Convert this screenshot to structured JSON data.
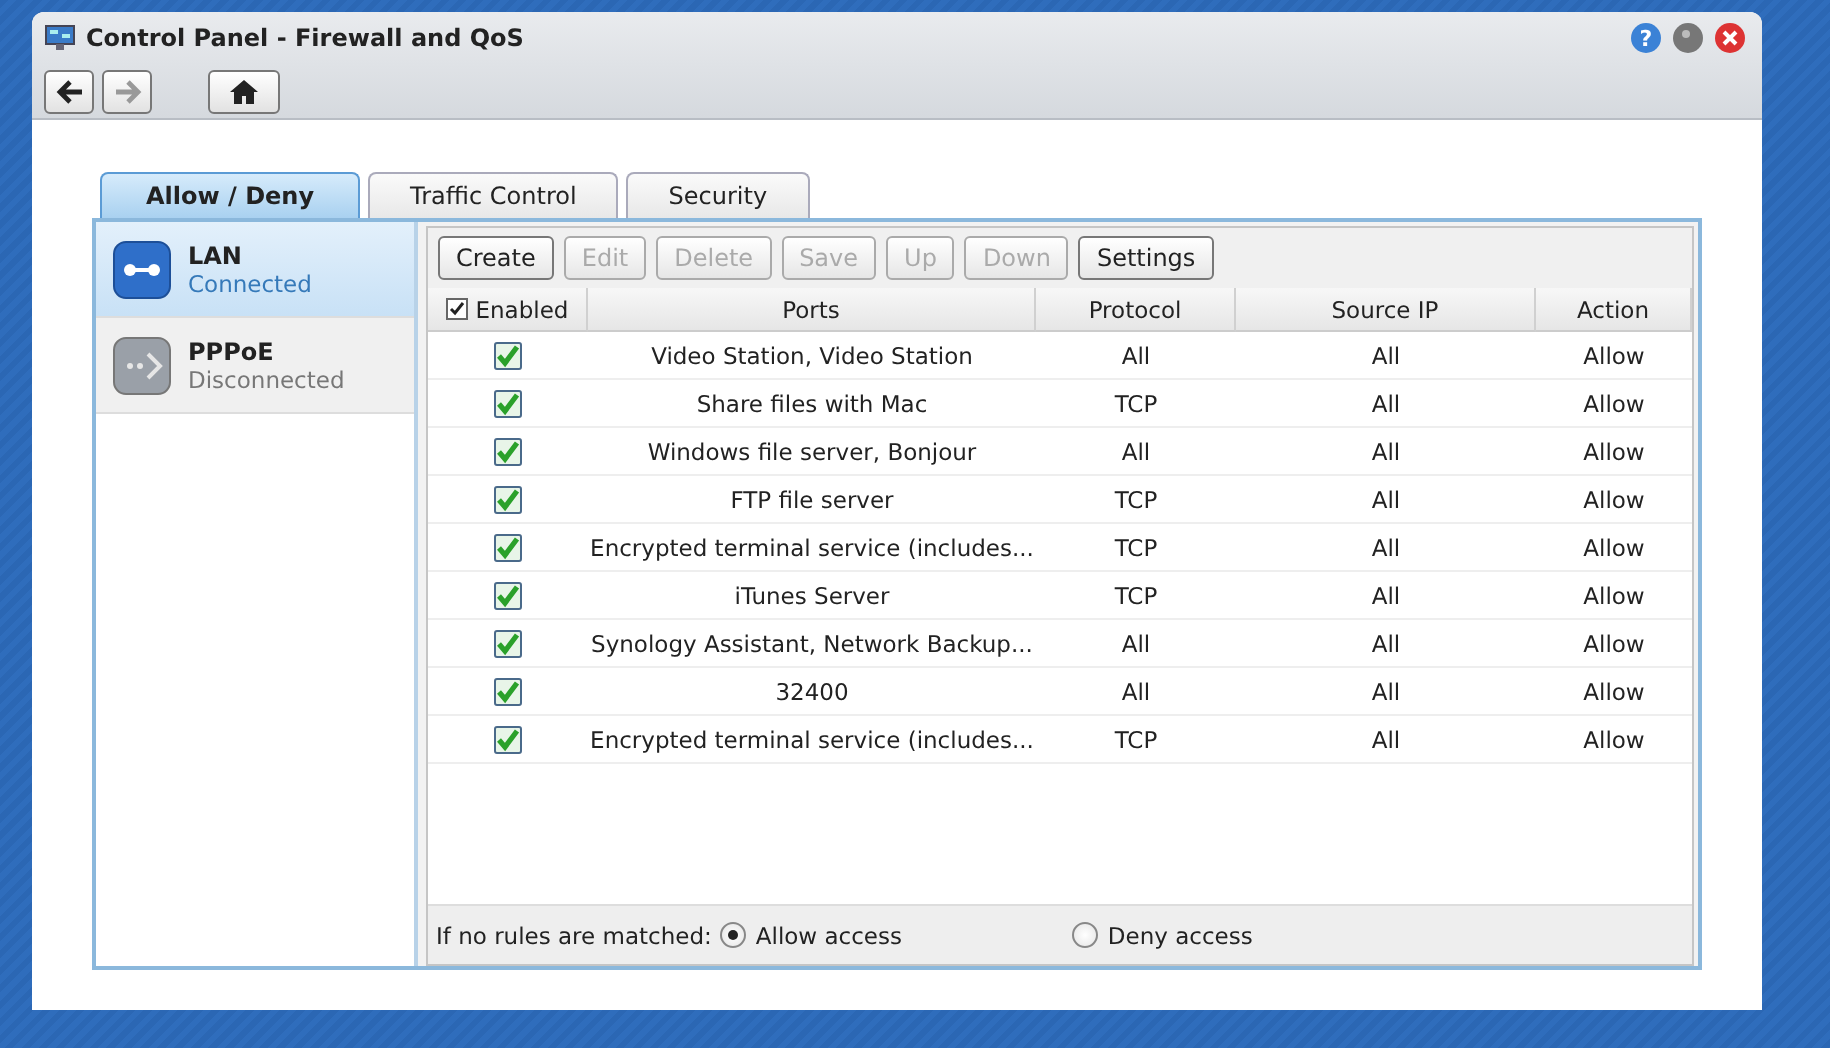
{
  "window": {
    "title": "Control Panel - Firewall and QoS",
    "help_glyph": "?"
  },
  "nav": {
    "back_disabled": false,
    "forward_disabled": true
  },
  "tabs": [
    {
      "label": "Allow / Deny",
      "selected": true
    },
    {
      "label": "Traffic Control",
      "selected": false
    },
    {
      "label": "Security",
      "selected": false
    }
  ],
  "interfaces": [
    {
      "name": "LAN",
      "status": "Connected",
      "selected": true,
      "connected": true
    },
    {
      "name": "PPPoE",
      "status": "Disconnected",
      "selected": false,
      "connected": false
    }
  ],
  "toolbar": [
    {
      "label": "Create",
      "disabled": false
    },
    {
      "label": "Edit",
      "disabled": true
    },
    {
      "label": "Delete",
      "disabled": true
    },
    {
      "label": "Save",
      "disabled": true
    },
    {
      "label": "Up",
      "disabled": true
    },
    {
      "label": "Down",
      "disabled": true
    },
    {
      "label": "Settings",
      "disabled": false
    }
  ],
  "table": {
    "enabled_header": {
      "label": "Enabled",
      "checked": true
    },
    "columns": [
      "Ports",
      "Protocol",
      "Source IP",
      "Action"
    ],
    "rows": [
      {
        "enabled": true,
        "ports": "Video Station, Video Station",
        "protocol": "All",
        "source_ip": "All",
        "action": "Allow"
      },
      {
        "enabled": true,
        "ports": "Share files with Mac",
        "protocol": "TCP",
        "source_ip": "All",
        "action": "Allow"
      },
      {
        "enabled": true,
        "ports": "Windows file server, Bonjour",
        "protocol": "All",
        "source_ip": "All",
        "action": "Allow"
      },
      {
        "enabled": true,
        "ports": "FTP file server",
        "protocol": "TCP",
        "source_ip": "All",
        "action": "Allow"
      },
      {
        "enabled": true,
        "ports": "Encrypted terminal service (includes...",
        "protocol": "TCP",
        "source_ip": "All",
        "action": "Allow"
      },
      {
        "enabled": true,
        "ports": "iTunes Server",
        "protocol": "TCP",
        "source_ip": "All",
        "action": "Allow"
      },
      {
        "enabled": true,
        "ports": "Synology Assistant, Network Backup...",
        "protocol": "All",
        "source_ip": "All",
        "action": "Allow"
      },
      {
        "enabled": true,
        "ports": "32400",
        "protocol": "All",
        "source_ip": "All",
        "action": "Allow"
      },
      {
        "enabled": true,
        "ports": "Encrypted terminal service (includes...",
        "protocol": "TCP",
        "source_ip": "All",
        "action": "Allow"
      }
    ]
  },
  "footer": {
    "label": "If no rules are matched:",
    "options": [
      {
        "label": "Allow access",
        "selected": true
      },
      {
        "label": "Deny access",
        "selected": false
      }
    ]
  }
}
